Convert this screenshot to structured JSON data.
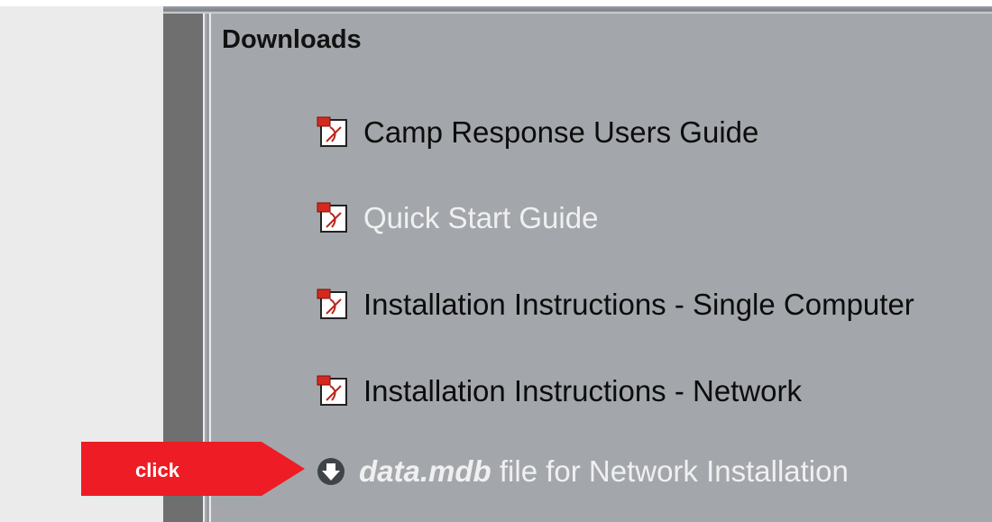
{
  "panel": {
    "title": "Downloads"
  },
  "downloads": [
    {
      "label": "Camp Response Users Guide",
      "icon": "pdf-icon"
    },
    {
      "label": "Quick Start Guide",
      "icon": "pdf-icon"
    },
    {
      "label": "Installation Instructions - Single Computer",
      "icon": "pdf-icon"
    },
    {
      "label": "Installation Instructions - Network",
      "icon": "pdf-icon"
    },
    {
      "label_bold": "data.mdb",
      "label_rest": " file for Network Installation",
      "icon": "download-circle-icon"
    }
  ],
  "callout": {
    "text": "click",
    "color": "#ee1c24"
  }
}
